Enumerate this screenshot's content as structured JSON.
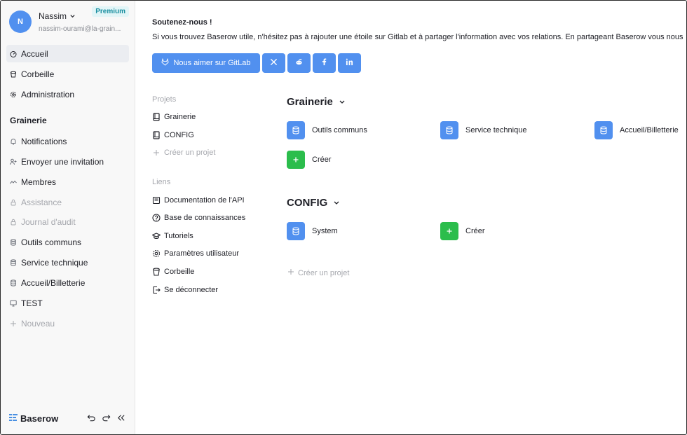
{
  "user": {
    "initial": "N",
    "name": "Nassim",
    "email": "nassim-ourami@la-grain...",
    "badge": "Premium"
  },
  "sidebar": {
    "top_items": [
      {
        "label": "Accueil",
        "icon": "dashboard-icon"
      },
      {
        "label": "Corbeille",
        "icon": "trash-icon"
      },
      {
        "label": "Administration",
        "icon": "gear-icon"
      }
    ],
    "workspace_title": "Grainerie",
    "workspace_items": [
      {
        "label": "Notifications",
        "icon": "bell-icon"
      },
      {
        "label": "Envoyer une invitation",
        "icon": "user-add-icon"
      },
      {
        "label": "Membres",
        "icon": "members-icon"
      },
      {
        "label": "Assistance",
        "icon": "lock-icon"
      },
      {
        "label": "Journal d'audit",
        "icon": "lock-icon"
      },
      {
        "label": "Outils communs",
        "icon": "database-icon"
      },
      {
        "label": "Service technique",
        "icon": "database-icon"
      },
      {
        "label": "Accueil/Billetterie",
        "icon": "database-icon"
      },
      {
        "label": "TEST",
        "icon": "monitor-icon"
      },
      {
        "label": "Nouveau",
        "icon": "plus-icon"
      }
    ],
    "logo": "Baserow"
  },
  "main": {
    "support_title": "Soutenez-nous !",
    "support_text": "Si vous trouvez Baserow utile, n'hésitez pas à rajouter une étoile sur Gitlab et à partager l'information avec vos relations. En partageant Baserow vous nous",
    "gitlab_button": "Nous aimer sur GitLab",
    "projects_label": "Projets",
    "projects": [
      {
        "label": "Grainerie",
        "icon": "book-icon"
      },
      {
        "label": "CONFIG",
        "icon": "book-icon"
      }
    ],
    "create_project_label": "Créer un projet",
    "links_label": "Liens",
    "links": [
      {
        "label": "Documentation de l'API",
        "icon": "book-open-icon"
      },
      {
        "label": "Base de connaissances",
        "icon": "help-icon"
      },
      {
        "label": "Tutoriels",
        "icon": "graduation-icon"
      },
      {
        "label": "Paramètres utilisateur",
        "icon": "gear-icon"
      },
      {
        "label": "Corbeille",
        "icon": "trash-icon"
      },
      {
        "label": "Se déconnecter",
        "icon": "logout-icon"
      }
    ],
    "groups": [
      {
        "title": "Grainerie",
        "databases": [
          "Outils communs",
          "Service technique",
          "Accueil/Billetterie"
        ],
        "create_label": "Créer"
      },
      {
        "title": "CONFIG",
        "databases": [
          "System"
        ],
        "create_label": "Créer"
      }
    ],
    "bottom_create_project": "Créer un projet"
  },
  "colors": {
    "accent": "#5190ef",
    "create": "#2bbd4c",
    "muted": "#a5a7ad"
  }
}
